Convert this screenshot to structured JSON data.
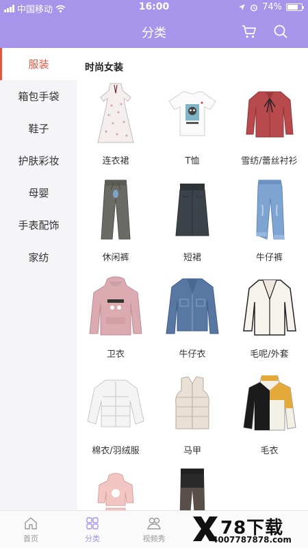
{
  "status_bar": {
    "carrier": "中国移动",
    "time": "16:00",
    "battery": "74%",
    "battery_level": 0.74
  },
  "header": {
    "title": "分类",
    "cart_icon": "cart-icon",
    "search_icon": "search-icon"
  },
  "sidebar": {
    "items": [
      {
        "label": "服装",
        "active": true
      },
      {
        "label": "箱包手袋",
        "active": false
      },
      {
        "label": "鞋子",
        "active": false
      },
      {
        "label": "护肤彩妆",
        "active": false
      },
      {
        "label": "母婴",
        "active": false
      },
      {
        "label": "手表配饰",
        "active": false
      },
      {
        "label": "家纺",
        "active": false
      }
    ]
  },
  "content": {
    "section_title": "时尚女装",
    "items": [
      {
        "label": "连衣裙",
        "icon": "dress-icon"
      },
      {
        "label": "T恤",
        "icon": "tshirt-icon"
      },
      {
        "label": "雪纺/蕾丝衬衫",
        "icon": "blouse-icon"
      },
      {
        "label": "休闲裤",
        "icon": "casual-pants-icon"
      },
      {
        "label": "短裙",
        "icon": "skirt-icon"
      },
      {
        "label": "牛仔裤",
        "icon": "jeans-icon"
      },
      {
        "label": "卫衣",
        "icon": "hoodie-icon"
      },
      {
        "label": "牛仔衣",
        "icon": "denim-jacket-icon"
      },
      {
        "label": "毛呢/外套",
        "icon": "wool-coat-icon"
      },
      {
        "label": "棉衣/羽绒服",
        "icon": "down-jacket-icon"
      },
      {
        "label": "马甲",
        "icon": "vest-icon"
      },
      {
        "label": "毛衣",
        "icon": "sweater-icon"
      },
      {
        "label": "",
        "icon": "kids-set-icon"
      },
      {
        "label": "",
        "icon": "leggings-icon"
      }
    ]
  },
  "tabbar": {
    "tabs": [
      {
        "label": "首页",
        "icon": "home-icon",
        "active": false
      },
      {
        "label": "分类",
        "icon": "category-icon",
        "active": true
      },
      {
        "label": "视频秀",
        "icon": "video-show-icon",
        "active": false
      }
    ]
  },
  "watermark": {
    "brand": "78下载",
    "url": "4007787878.com"
  },
  "colors": {
    "header": "#a795ec",
    "active_red": "#e0563f",
    "sidebar_bg": "#f5f5f7"
  }
}
